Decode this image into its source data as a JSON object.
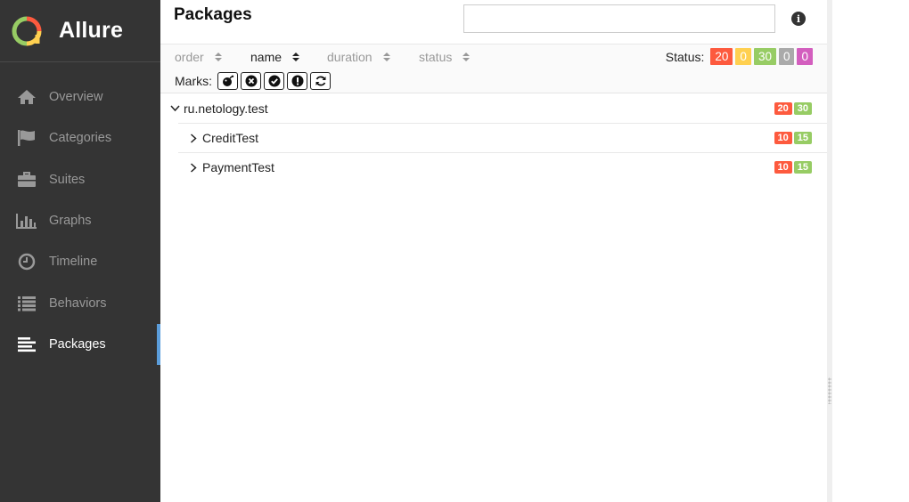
{
  "sidebar": {
    "brand": "Allure",
    "items": [
      {
        "label": "Overview",
        "icon": "home-icon"
      },
      {
        "label": "Categories",
        "icon": "flag-icon"
      },
      {
        "label": "Suites",
        "icon": "briefcase-icon"
      },
      {
        "label": "Graphs",
        "icon": "bar-chart-icon"
      },
      {
        "label": "Timeline",
        "icon": "clock-icon"
      },
      {
        "label": "Behaviors",
        "icon": "list-icon"
      },
      {
        "label": "Packages",
        "icon": "align-left-icon",
        "active": true
      }
    ]
  },
  "main": {
    "title": "Packages",
    "search": {
      "value": "",
      "placeholder": ""
    },
    "info_icon": "info-icon",
    "sorters": {
      "order": "order",
      "name": "name",
      "duration": "duration",
      "status": "status",
      "active": "name"
    },
    "status_label": "Status:",
    "status_counts": [
      {
        "status": "failed",
        "count": "20",
        "color": "#fd5a3e"
      },
      {
        "status": "broken",
        "count": "0",
        "color": "#ffd050"
      },
      {
        "status": "passed",
        "count": "30",
        "color": "#97cc64"
      },
      {
        "status": "skipped",
        "count": "0",
        "color": "#aaaaaa"
      },
      {
        "status": "unknown",
        "count": "0",
        "color": "#d35ebe"
      }
    ],
    "marks_label": "Marks:",
    "marks": [
      "bomb-icon",
      "times-circle-icon",
      "check-circle-icon",
      "exclamation-circle-icon",
      "refresh-icon"
    ],
    "tree": {
      "root": {
        "name": "ru.netology.test",
        "failed": "20",
        "passed": "30"
      },
      "children": [
        {
          "name": "CreditTest",
          "failed": "10",
          "passed": "15"
        },
        {
          "name": "PaymentTest",
          "failed": "10",
          "passed": "15"
        }
      ]
    }
  },
  "colors": {
    "sidebar_bg": "#343434",
    "active_accent": "#5b9ddb",
    "failed": "#fd5a3e",
    "passed": "#97cc64"
  }
}
